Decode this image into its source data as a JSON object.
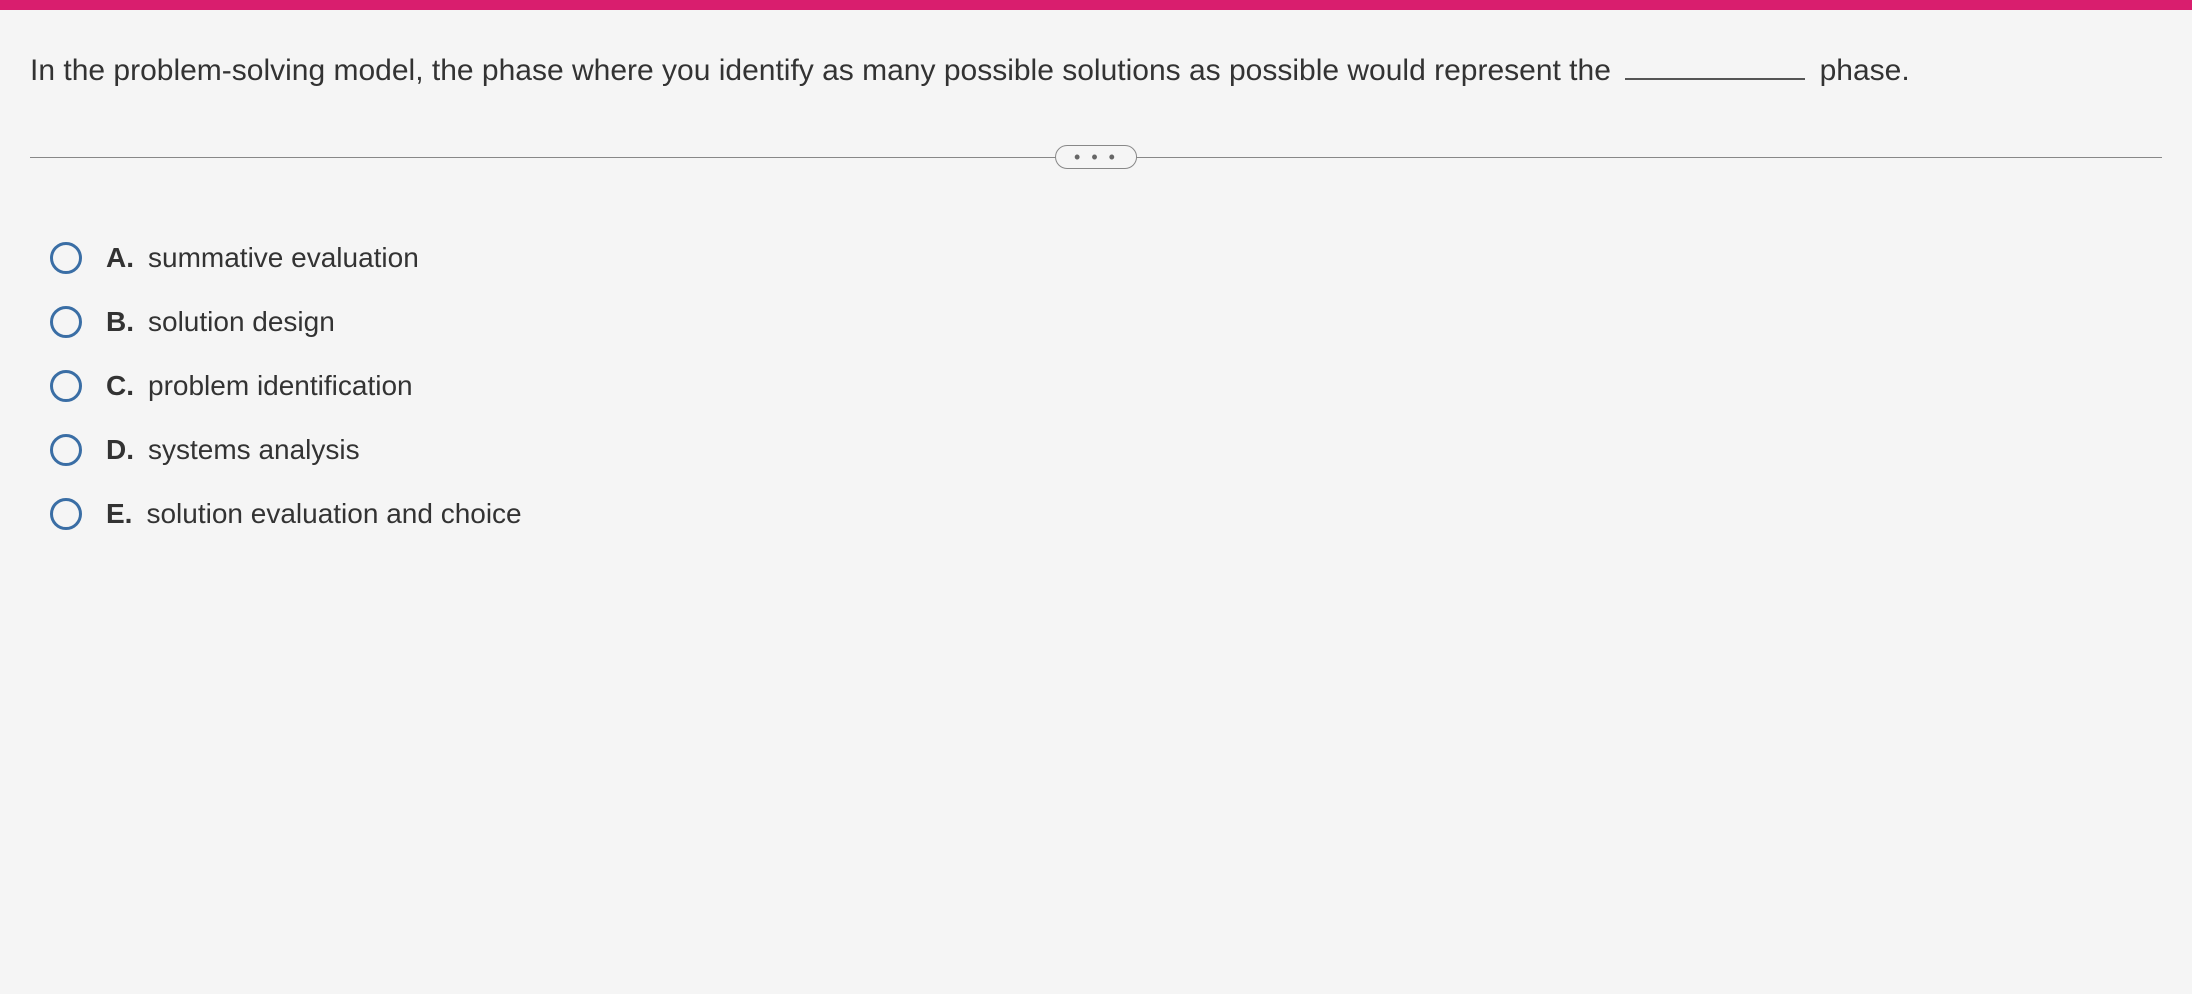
{
  "question": {
    "text_before": "In the problem-solving model, the phase where you identify as many possible solutions as possible would represent the",
    "text_after": "phase."
  },
  "divider": {
    "label": "• • •"
  },
  "options": [
    {
      "letter": "A.",
      "text": "summative evaluation"
    },
    {
      "letter": "B.",
      "text": "solution design"
    },
    {
      "letter": "C.",
      "text": "problem identification"
    },
    {
      "letter": "D.",
      "text": "systems analysis"
    },
    {
      "letter": "E.",
      "text": "solution evaluation and choice"
    }
  ]
}
